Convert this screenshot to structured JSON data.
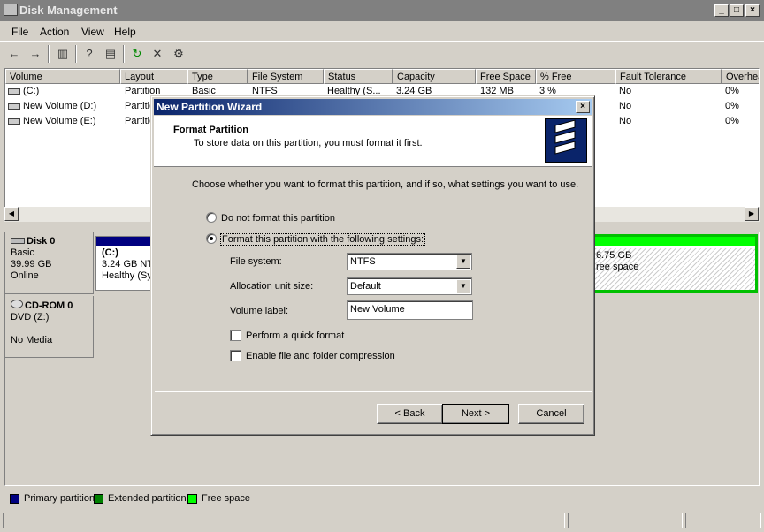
{
  "window": {
    "title": "Disk Management"
  },
  "menu": [
    {
      "label": "File",
      "accel": "F"
    },
    {
      "label": "Action",
      "accel": "A"
    },
    {
      "label": "View",
      "accel": "V"
    },
    {
      "label": "Help",
      "accel": "H"
    }
  ],
  "columns": [
    "Volume",
    "Layout",
    "Type",
    "File System",
    "Status",
    "Capacity",
    "Free Space",
    "% Free",
    "Fault Tolerance",
    "Overhead"
  ],
  "volumes": [
    {
      "volume": "(C:)",
      "layout": "Partition",
      "type": "Basic",
      "fs": "NTFS",
      "status": "Healthy (S...",
      "capacity": "3.24 GB",
      "free": "132 MB",
      "pct": "3 %",
      "fault": "No",
      "overhead": "0%"
    },
    {
      "volume": "New Volume (D:)",
      "layout": "Partition",
      "fault": "No",
      "overhead": "0%"
    },
    {
      "volume": "New Volume (E:)",
      "layout": "Partition",
      "fault": "No",
      "overhead": "0%"
    }
  ],
  "disks": {
    "disk0": {
      "name": "Disk 0",
      "type": "Basic",
      "size": "39.99 GB",
      "state": "Online",
      "part_c": {
        "label": "(C:)",
        "size": "3.24 GB NTFS",
        "status": "Healthy (Sy"
      },
      "part_free": {
        "size": "6.75 GB",
        "status": "ree space"
      }
    },
    "cdrom0": {
      "name": "CD-ROM 0",
      "type": "DVD (Z:)",
      "state": "No Media"
    }
  },
  "legend": [
    {
      "label": "Primary partition",
      "color": "#000080"
    },
    {
      "label": "Extended partition",
      "color": "#008000"
    },
    {
      "label": "Free space",
      "color": "#00ff00"
    }
  ],
  "wizard": {
    "title": "New Partition Wizard",
    "heading": "Format Partition",
    "subheading": "To store data on this partition, you must format it first.",
    "instruction": "Choose whether you want to format this partition, and if so, what settings you want to use.",
    "option_no_format": "Do not format this partition",
    "option_format": "Format this partition with the following settings:",
    "fs_label": "File system:",
    "fs_value": "NTFS",
    "alloc_label": "Allocation unit size:",
    "alloc_value": "Default",
    "vol_label": "Volume label:",
    "vol_value": "New Volume",
    "quick_format": "Perform a quick format",
    "compression": "Enable file and folder compression",
    "back": "< Back",
    "next": "Next >",
    "cancel": "Cancel"
  }
}
